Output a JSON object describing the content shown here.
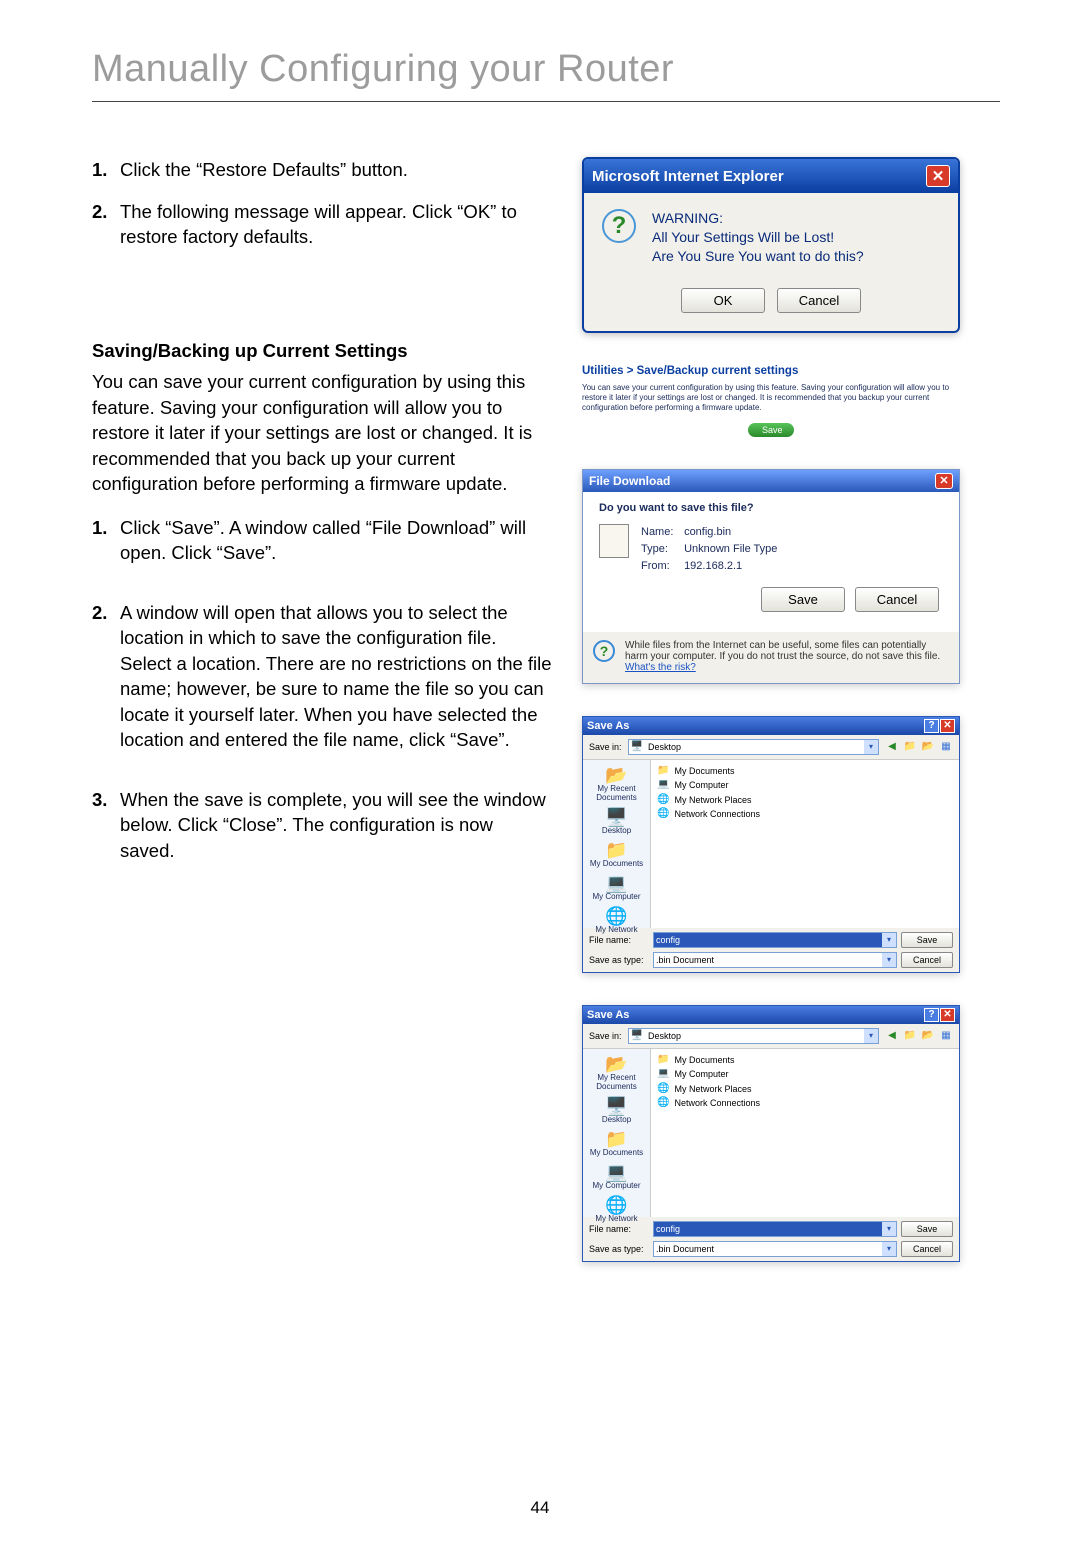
{
  "page_title": "Manually Configuring your Router",
  "page_number": "44",
  "intro_steps": [
    {
      "num": "1.",
      "text": "Click the “Restore Defaults” button."
    },
    {
      "num": "2.",
      "text": "The following message will appear. Click “OK” to restore factory defaults."
    }
  ],
  "section_heading": "Saving/Backing up Current Settings",
  "section_intro": "You can save your current configuration by using this feature. Saving your configuration will allow you to restore it later if your settings are lost or changed. It is recommended that you back up your current configuration before performing a firmware update.",
  "save_steps": [
    {
      "num": "1.",
      "text": "Click “Save”. A window called “File Download” will open. Click “Save”."
    },
    {
      "num": "2.",
      "text": "A window will open that allows you to select the location in which to save the configuration file. Select a location. There are no restrictions on the file name; however, be sure to name the file so you can locate it yourself later. When you have selected the location and entered the file name, click “Save”."
    },
    {
      "num": "3.",
      "text": "When the save is complete, you will see the window below. Click “Close”. The configuration is now saved."
    }
  ],
  "ie_dialog": {
    "title": "Microsoft Internet Explorer",
    "warn_label": "WARNING:",
    "line1": "All Your Settings Will be Lost!",
    "line2": "Are You Sure You want to do this?",
    "ok": "OK",
    "cancel": "Cancel"
  },
  "util": {
    "breadcrumb": "Utilities > Save/Backup current settings",
    "text": "You can save your current configuration by using this feature. Saving your configuration will allow you to restore it later if your settings are lost or changed. It is recommended that you backup your current configuration before performing a firmware update.",
    "save": "Save"
  },
  "file_download": {
    "title": "File Download",
    "question": "Do you want to save this file?",
    "name_lbl": "Name:",
    "name_val": "config.bin",
    "type_lbl": "Type:",
    "type_val": "Unknown File Type",
    "from_lbl": "From:",
    "from_val": "192.168.2.1",
    "save": "Save",
    "cancel": "Cancel",
    "warn": "While files from the Internet can be useful, some files can potentially harm your computer. If you do not trust the source, do not save this file.",
    "risk": "What's the risk?"
  },
  "save_as": {
    "title": "Save As",
    "savein_lbl": "Save in:",
    "savein_val": "Desktop",
    "folders": [
      "My Documents",
      "My Computer",
      "My Network Places",
      "Network Connections"
    ],
    "side": [
      {
        "icon": "📂",
        "label": "My Recent Documents"
      },
      {
        "icon": "🖥️",
        "label": "Desktop"
      },
      {
        "icon": "📁",
        "label": "My Documents"
      },
      {
        "icon": "💻",
        "label": "My Computer"
      },
      {
        "icon": "🌐",
        "label": "My Network"
      }
    ],
    "filename_lbl": "File name:",
    "filename_val": "config",
    "saveastype_lbl": "Save as type:",
    "saveastype_val": ".bin Document",
    "save": "Save",
    "cancel": "Cancel"
  }
}
